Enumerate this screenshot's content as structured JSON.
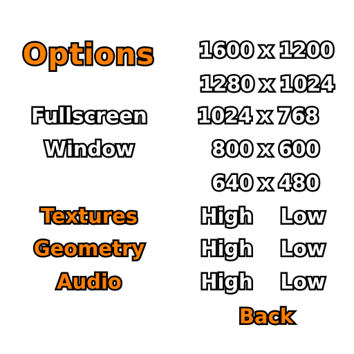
{
  "title": "Options",
  "display_modes": {
    "fullscreen": "Fullscreen",
    "window": "Window"
  },
  "resolutions": [
    "1600 x 1200",
    "1280 x 1024",
    "1024 x 768",
    "800 x 600",
    "640 x 480"
  ],
  "settings": {
    "textures": {
      "label": "Textures",
      "high": "High",
      "low": "Low"
    },
    "geometry": {
      "label": "Geometry",
      "high": "High",
      "low": "Low"
    },
    "audio": {
      "label": "Audio",
      "high": "High",
      "low": "Low"
    }
  },
  "back_label": "Back",
  "colors": {
    "highlight": "#ff7f00",
    "normal": "#ffffff",
    "outline": "#000000",
    "background": "#ffffff"
  }
}
